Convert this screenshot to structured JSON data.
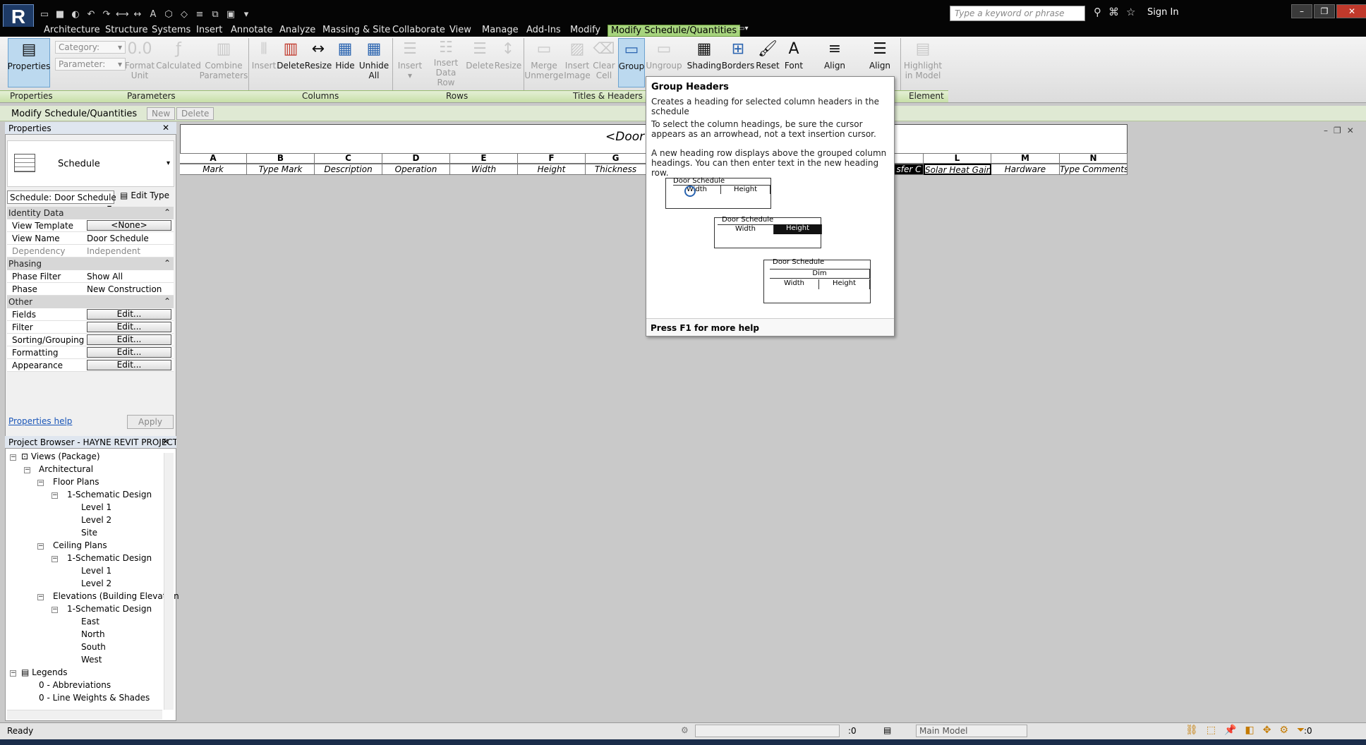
{
  "app": {
    "logo": "R"
  },
  "search": {
    "placeholder": "Type a keyword or phrase"
  },
  "header": {
    "sign_in": "Sign In"
  },
  "tabs": [
    "Architecture",
    "Structure",
    "Systems",
    "Insert",
    "Annotate",
    "Analyze",
    "Massing & Site",
    "Collaborate",
    "View",
    "Manage",
    "Add-Ins",
    "Modify",
    "Modify Schedule/Quantities"
  ],
  "ribbon": {
    "properties": "Properties",
    "category": "Category:",
    "parameter": "Parameter:",
    "format_unit": [
      "Format",
      "Unit"
    ],
    "calculated": "Calculated",
    "combine": [
      "Combine",
      "Parameters"
    ],
    "insert": "Insert",
    "delete": "Delete",
    "resize": "Resize",
    "hide": "Hide",
    "unhide": [
      "Unhide",
      "All"
    ],
    "rows_insert": "Insert",
    "insert_data_row": [
      "Insert",
      "Data Row"
    ],
    "rows_delete": "Delete",
    "rows_resize": "Resize",
    "merge": [
      "Merge",
      "Unmerge"
    ],
    "insert_image": [
      "Insert",
      "Image"
    ],
    "clear_cell": [
      "Clear",
      "Cell"
    ],
    "group": "Group",
    "ungroup": "Ungroup",
    "shading": "Shading",
    "borders": "Borders",
    "reset": "Reset",
    "font": "Font",
    "align_h": "Align",
    "align_v": "Align",
    "highlight": [
      "Highlight",
      "in Model"
    ],
    "panels": [
      "Properties",
      "Parameters",
      "Columns",
      "Rows",
      "Titles & Headers",
      "Element"
    ]
  },
  "context_bar": {
    "label": "Modify Schedule/Quantities",
    "new": "New",
    "delete": "Delete"
  },
  "properties": {
    "title": "Properties",
    "type_name": "Schedule",
    "schedule_selector": "Schedule: Door Schedule",
    "edit_type": "Edit Type",
    "groups": [
      {
        "name": "Identity Data",
        "rows": [
          {
            "k": "View Template",
            "v": "<None>"
          },
          {
            "k": "View Name",
            "v": "Door Schedule"
          },
          {
            "k": "Dependency",
            "v": "Independent"
          }
        ]
      },
      {
        "name": "Phasing",
        "rows": [
          {
            "k": "Phase Filter",
            "v": "Show All"
          },
          {
            "k": "Phase",
            "v": "New Construction"
          }
        ]
      },
      {
        "name": "Other",
        "rows": [
          {
            "k": "Fields",
            "v": "Edit..."
          },
          {
            "k": "Filter",
            "v": "Edit..."
          },
          {
            "k": "Sorting/Grouping",
            "v": "Edit..."
          },
          {
            "k": "Formatting",
            "v": "Edit..."
          },
          {
            "k": "Appearance",
            "v": "Edit..."
          }
        ]
      }
    ],
    "help": "Properties help",
    "apply": "Apply"
  },
  "browser": {
    "title": "Project Browser - HAYNE REVIT PROJECT ...",
    "nodes": [
      "Views (Package)",
      "Architectural",
      "Floor Plans",
      "1-Schematic Design",
      "Level 1",
      "Level 2",
      "Site",
      "Ceiling Plans",
      "1-Schematic Design",
      "Level 1",
      "Level 2",
      "Elevations (Building Elevation",
      "1-Schematic Design",
      "East",
      "North",
      "South",
      "West",
      "Legends",
      "0 - Abbreviations",
      "0 - Line Weights & Shades"
    ]
  },
  "schedule": {
    "title": "<Door",
    "letters": [
      "A",
      "B",
      "C",
      "D",
      "E",
      "F",
      "G",
      "L",
      "M",
      "N"
    ],
    "headers": [
      "Mark",
      "Type Mark",
      "Description",
      "Operation",
      "Width",
      "Height",
      "Thickness",
      "sfer C",
      "Solar Heat Gain",
      "Hardware",
      "Type Comments"
    ]
  },
  "tooltip": {
    "title": "Group Headers",
    "line1": "Creates a heading for selected column headers in the schedule",
    "line2": "To select the column headings, be sure the cursor appears as an arrowhead, not a text insertion cursor.",
    "line3": "A new heading row displays above the grouped column headings. You can then enter text in the new heading row.",
    "mini1": [
      "Door Schedule",
      "Width",
      "Height"
    ],
    "mini2": [
      "Door Schedule",
      "Width",
      "Height"
    ],
    "mini3": [
      "Door Schedule",
      "Dim",
      "Width",
      "Height"
    ],
    "footer": "Press F1 for more help"
  },
  "status": {
    "ready": "Ready",
    "zero1": ":0",
    "model": "Main Model",
    "zero2": ":0"
  },
  "colors": {
    "ribbon_tab_active": "#a7d47e",
    "panel_bar": "#c7e0a8",
    "link": "#1a56b8"
  }
}
